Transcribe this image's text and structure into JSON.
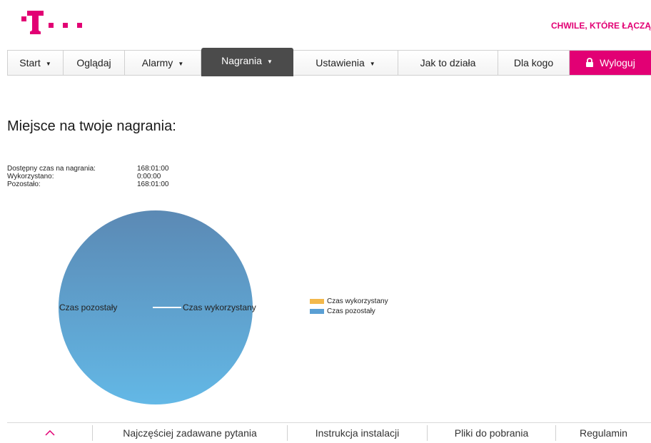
{
  "header": {
    "tagline": "CHWILE, KTÓRE ŁĄCZĄ",
    "brand_color": "#e20074"
  },
  "nav": {
    "items": [
      {
        "label": "Start",
        "has_dropdown": true
      },
      {
        "label": "Oglądaj",
        "has_dropdown": false
      },
      {
        "label": "Alarmy",
        "has_dropdown": true
      },
      {
        "label": "Nagrania",
        "has_dropdown": true,
        "active": true
      },
      {
        "label": "Ustawienia",
        "has_dropdown": true
      },
      {
        "label": "Jak to działa",
        "has_dropdown": false
      },
      {
        "label": "Dla kogo",
        "has_dropdown": false
      }
    ],
    "logout_label": "Wyloguj",
    "logout_icon": "lock-icon",
    "active_color": "#4b4b4b"
  },
  "main": {
    "title": "Miejsce na twoje nagrania:",
    "stats": [
      {
        "label": "Dostępny czas na nagrania:",
        "value": "168:01:00"
      },
      {
        "label": "Wykorzystano:",
        "value": "0:00:00"
      },
      {
        "label": "Pozostało:",
        "value": "168:01:00"
      }
    ]
  },
  "chart_data": {
    "type": "pie",
    "categories": [
      "Czas wykorzystany",
      "Czas pozostały"
    ],
    "values": [
      0,
      168.0167
    ],
    "colors": [
      "#f2b84b",
      "#5a9fd4"
    ],
    "legend_position": "right",
    "slice_labels": [
      "Czas pozostały",
      "Czas wykorzystany"
    ]
  },
  "footer": {
    "scroll_top_icon": "chevron-up-icon",
    "links": [
      "Najczęściej zadawane pytania",
      "Instrukcja instalacji",
      "Pliki do pobrania",
      "Regulamin"
    ]
  }
}
